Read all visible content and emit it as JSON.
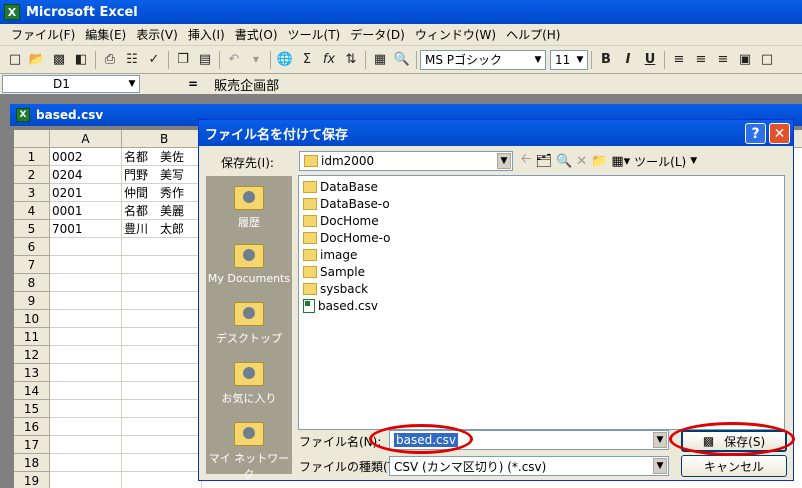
{
  "app": {
    "title": "Microsoft Excel",
    "icon": "excel-icon"
  },
  "menu": [
    "ファイル(F)",
    "編集(E)",
    "表示(V)",
    "挿入(I)",
    "書式(O)",
    "ツール(T)",
    "データ(D)",
    "ウィンドウ(W)",
    "ヘルプ(H)"
  ],
  "toolbar": {
    "font_name": "MS Pゴシック",
    "font_size": "11",
    "bold": "B",
    "italic": "I",
    "underline": "U"
  },
  "formula_bar": {
    "cell_ref": "D1",
    "eq": "=",
    "content": "販売企画部"
  },
  "workbook": {
    "title": "based.csv",
    "icon": "excel-icon"
  },
  "sheet": {
    "columns": [
      "A",
      "B"
    ],
    "rows": [
      "1",
      "2",
      "3",
      "4",
      "5",
      "6",
      "7",
      "8",
      "9",
      "10",
      "11",
      "12",
      "13",
      "14",
      "15",
      "16",
      "17",
      "18",
      "19"
    ],
    "cells": [
      [
        "0002",
        "名都　美佐"
      ],
      [
        "0204",
        "門野　美写"
      ],
      [
        "0201",
        "仲間　秀作"
      ],
      [
        "0001",
        "名都　美麗"
      ],
      [
        "7001",
        "豊川　太郎"
      ]
    ]
  },
  "dialog": {
    "title": "ファイル名を付けて保存",
    "save_in_label": "保存先(I):",
    "save_in_value": "idm2000",
    "tools_label": "ツール(L)",
    "places": [
      "履歴",
      "My Documents",
      "デスクトップ",
      "お気に入り",
      "マイ ネットワーク"
    ],
    "files": [
      {
        "name": "DataBase",
        "type": "folder"
      },
      {
        "name": "DataBase-o",
        "type": "folder"
      },
      {
        "name": "DocHome",
        "type": "folder"
      },
      {
        "name": "DocHome-o",
        "type": "folder"
      },
      {
        "name": "image",
        "type": "folder"
      },
      {
        "name": "Sample",
        "type": "folder"
      },
      {
        "name": "sysback",
        "type": "folder"
      },
      {
        "name": "based.csv",
        "type": "csv"
      }
    ],
    "filename_label": "ファイル名(N):",
    "filename_value": "based.csv",
    "filetype_label": "ファイルの種類(T):",
    "filetype_value": "CSV (カンマ区切り) (*.csv)",
    "save_button": "保存(S)",
    "cancel_button": "キャンセル"
  },
  "colors": {
    "titlebar": "#0054e3",
    "highlight": "#e00000",
    "selection": "#316ac5"
  }
}
